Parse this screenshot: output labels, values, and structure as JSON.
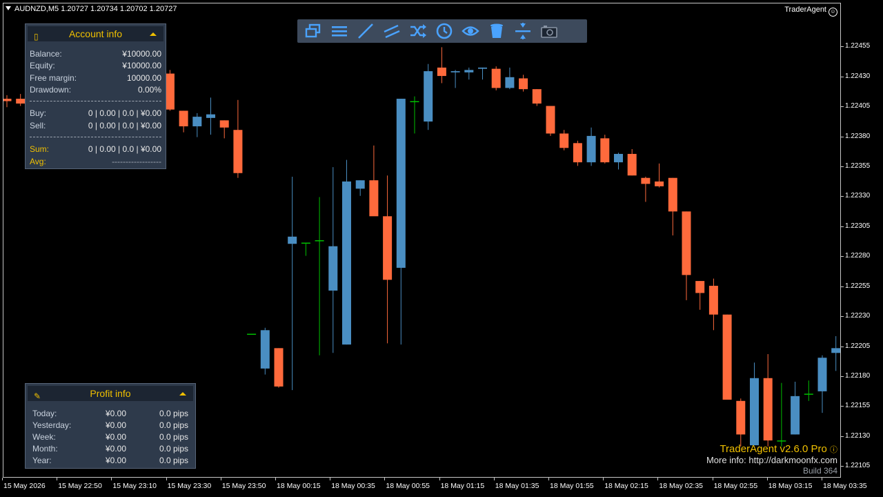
{
  "header": {
    "symbol_line": "AUDNZD,M5  1.20727 1.20734 1.20702 1.20727",
    "brand": "TraderAgent"
  },
  "colors": {
    "bull": "#4a8ec2",
    "bear": "#ff6a3c",
    "flat": "#00c000",
    "panel_bg": "#2e3a4b",
    "accent": "#f0c000"
  },
  "toolbar": {
    "tools": [
      {
        "icon": "windows-icon"
      },
      {
        "icon": "menu-icon"
      },
      {
        "icon": "trendline-icon"
      },
      {
        "icon": "parallel-lines-icon"
      },
      {
        "icon": "shuffle-icon"
      },
      {
        "icon": "clock-icon"
      },
      {
        "icon": "eye-icon"
      },
      {
        "icon": "trash-icon"
      },
      {
        "icon": "compress-icon"
      },
      {
        "icon": "camera-icon"
      }
    ]
  },
  "account": {
    "title": "Account info",
    "balance_label": "Balance:",
    "balance": "¥10000.00",
    "equity_label": "Equity:",
    "equity": "¥10000.00",
    "free_margin_label": "Free margin:",
    "free_margin": "10000.00",
    "drawdown_label": "Drawdown:",
    "drawdown": "0.00%",
    "buy_label": "Buy:",
    "buy": "0 | 0.00 | 0.0 | ¥0.00",
    "sell_label": "Sell:",
    "sell": "0 | 0.00 | 0.0 | ¥0.00",
    "sum_label": "Sum:",
    "sum": "0 | 0.00 | 0.0 | ¥0.00",
    "avg_label": "Avg:",
    "avg": "------------------"
  },
  "profit": {
    "title": "Profit info",
    "rows": [
      {
        "label": "Today:",
        "money": "¥0.00",
        "pips": "0.0 pips"
      },
      {
        "label": "Yesterday:",
        "money": "¥0.00",
        "pips": "0.0 pips"
      },
      {
        "label": "Week:",
        "money": "¥0.00",
        "pips": "0.0 pips"
      },
      {
        "label": "Month:",
        "money": "¥0.00",
        "pips": "0.0 pips"
      },
      {
        "label": "Year:",
        "money": "¥0.00",
        "pips": "0.0 pips"
      }
    ]
  },
  "footer": {
    "version": "TraderAgent v2.6.0 Pro",
    "more_info": "More info: http://darkmoonfx.com",
    "build": "Build 364"
  },
  "chart_data": {
    "type": "candlestick",
    "symbol": "AUDNZD",
    "timeframe": "M5",
    "ylim": [
      1.221,
      1.22465
    ],
    "price_ticks": [
      "1.22455",
      "1.22430",
      "1.22405",
      "1.22380",
      "1.22355",
      "1.22330",
      "1.22305",
      "1.22280",
      "1.22255",
      "1.22230",
      "1.22205",
      "1.22180",
      "1.22155",
      "1.22130",
      "1.22105"
    ],
    "time_ticks": [
      "15 May 2026",
      "15 May 22:50",
      "15 May 23:10",
      "15 May 23:30",
      "15 May 23:50",
      "18 May 00:15",
      "18 May 00:35",
      "18 May 00:55",
      "18 May 01:15",
      "18 May 01:35",
      "18 May 01:55",
      "18 May 02:15",
      "18 May 02:35",
      "18 May 02:55",
      "18 May 03:15",
      "18 May 03:35"
    ],
    "candles": [
      {
        "o": 1.22412,
        "h": 1.22415,
        "l": 1.22405,
        "c": 1.2241
      },
      {
        "o": 1.22412,
        "h": 1.22416,
        "l": 1.22406,
        "c": 1.22408
      },
      {
        "o": 1.22408,
        "h": 1.22418,
        "l": 1.22405,
        "c": 1.22412
      },
      {
        "o": 1.2241,
        "h": 1.22416,
        "l": 1.22404,
        "c": 1.2241
      },
      {
        "o": 1.22408,
        "h": 1.22416,
        "l": 1.224,
        "c": 1.22406
      },
      {
        "o": 1.22412,
        "h": 1.22432,
        "l": 1.22404,
        "c": 1.22424
      },
      {
        "o": 1.22425,
        "h": 1.22428,
        "l": 1.22404,
        "c": 1.22409
      },
      {
        "o": 1.22411,
        "h": 1.22413,
        "l": 1.22406,
        "c": 1.22408
      },
      {
        "o": 1.2241,
        "h": 1.22416,
        "l": 1.22405,
        "c": 1.22412
      },
      {
        "o": 1.22414,
        "h": 1.22418,
        "l": 1.22394,
        "c": 1.224
      },
      {
        "o": 1.224,
        "h": 1.22409,
        "l": 1.22396,
        "c": 1.22404
      },
      {
        "o": 1.22404,
        "h": 1.22434,
        "l": 1.224,
        "c": 1.22434
      },
      {
        "o": 1.22433,
        "h": 1.22436,
        "l": 1.22402,
        "c": 1.22403
      },
      {
        "o": 1.22402,
        "h": 1.22402,
        "l": 1.22384,
        "c": 1.22389
      },
      {
        "o": 1.22389,
        "h": 1.224,
        "l": 1.2238,
        "c": 1.22397
      },
      {
        "o": 1.22396,
        "h": 1.22413,
        "l": 1.22382,
        "c": 1.22399
      },
      {
        "o": 1.22394,
        "h": 1.22394,
        "l": 1.22379,
        "c": 1.22388
      },
      {
        "o": 1.22386,
        "h": 1.22411,
        "l": 1.22346,
        "c": 1.2235
      },
      {
        "o": 1.22216,
        "h": 1.22216,
        "l": 1.22216,
        "c": 1.22216
      },
      {
        "o": 1.22187,
        "h": 1.22221,
        "l": 1.22182,
        "c": 1.22219
      },
      {
        "o": 1.22204,
        "h": 1.22204,
        "l": 1.22171,
        "c": 1.22172
      },
      {
        "o": 1.22291,
        "h": 1.22347,
        "l": 1.22169,
        "c": 1.22297
      },
      {
        "o": 1.22292,
        "h": 1.22292,
        "l": 1.22281,
        "c": 1.22292
      },
      {
        "o": 1.22294,
        "h": 1.2233,
        "l": 1.22198,
        "c": 1.22294
      },
      {
        "o": 1.22252,
        "h": 1.22355,
        "l": 1.222,
        "c": 1.22289
      },
      {
        "o": 1.22207,
        "h": 1.22361,
        "l": 1.22207,
        "c": 1.22343
      },
      {
        "o": 1.22337,
        "h": 1.22344,
        "l": 1.22331,
        "c": 1.22344
      },
      {
        "o": 1.22344,
        "h": 1.22373,
        "l": 1.22317,
        "c": 1.22314
      },
      {
        "o": 1.22314,
        "h": 1.22348,
        "l": 1.22208,
        "c": 1.22261
      },
      {
        "o": 1.22271,
        "h": 1.22412,
        "l": 1.22207,
        "c": 1.22412
      },
      {
        "o": 1.2241,
        "h": 1.22414,
        "l": 1.22383,
        "c": 1.2241
      },
      {
        "o": 1.22393,
        "h": 1.22441,
        "l": 1.22386,
        "c": 1.22435
      },
      {
        "o": 1.22438,
        "h": 1.22455,
        "l": 1.22425,
        "c": 1.22431
      },
      {
        "o": 1.22434,
        "h": 1.22436,
        "l": 1.22421,
        "c": 1.22435
      },
      {
        "o": 1.22434,
        "h": 1.22438,
        "l": 1.22428,
        "c": 1.22436
      },
      {
        "o": 1.22437,
        "h": 1.22438,
        "l": 1.22428,
        "c": 1.22438
      },
      {
        "o": 1.22437,
        "h": 1.22439,
        "l": 1.22419,
        "c": 1.22421
      },
      {
        "o": 1.22421,
        "h": 1.22438,
        "l": 1.2242,
        "c": 1.2243
      },
      {
        "o": 1.22429,
        "h": 1.22432,
        "l": 1.22418,
        "c": 1.2242
      },
      {
        "o": 1.2242,
        "h": 1.2242,
        "l": 1.22406,
        "c": 1.22408
      },
      {
        "o": 1.22406,
        "h": 1.22406,
        "l": 1.22381,
        "c": 1.22383
      },
      {
        "o": 1.22383,
        "h": 1.22386,
        "l": 1.22369,
        "c": 1.22371
      },
      {
        "o": 1.22375,
        "h": 1.22377,
        "l": 1.22356,
        "c": 1.22359
      },
      {
        "o": 1.22359,
        "h": 1.22388,
        "l": 1.22356,
        "c": 1.22381
      },
      {
        "o": 1.22379,
        "h": 1.22382,
        "l": 1.22358,
        "c": 1.22359
      },
      {
        "o": 1.22359,
        "h": 1.22367,
        "l": 1.22353,
        "c": 1.22366
      },
      {
        "o": 1.22366,
        "h": 1.2237,
        "l": 1.22348,
        "c": 1.22348
      },
      {
        "o": 1.22346,
        "h": 1.22347,
        "l": 1.22326,
        "c": 1.22341
      },
      {
        "o": 1.22343,
        "h": 1.22358,
        "l": 1.22338,
        "c": 1.22339
      },
      {
        "o": 1.22346,
        "h": 1.22346,
        "l": 1.22298,
        "c": 1.22318
      },
      {
        "o": 1.22318,
        "h": 1.22318,
        "l": 1.22244,
        "c": 1.22265
      },
      {
        "o": 1.2226,
        "h": 1.2226,
        "l": 1.22236,
        "c": 1.2225
      },
      {
        "o": 1.22256,
        "h": 1.22262,
        "l": 1.22219,
        "c": 1.22232
      },
      {
        "o": 1.22232,
        "h": 1.22232,
        "l": 1.22164,
        "c": 1.22161
      },
      {
        "o": 1.2216,
        "h": 1.22162,
        "l": 1.22122,
        "c": 1.22132
      },
      {
        "o": 1.22123,
        "h": 1.22192,
        "l": 1.22123,
        "c": 1.22179
      },
      {
        "o": 1.22179,
        "h": 1.22199,
        "l": 1.22122,
        "c": 1.22127
      },
      {
        "o": 1.22127,
        "h": 1.22175,
        "l": 1.22122,
        "c": 1.22127
      },
      {
        "o": 1.22132,
        "h": 1.22176,
        "l": 1.22132,
        "c": 1.22164
      },
      {
        "o": 1.22166,
        "h": 1.22177,
        "l": 1.2216,
        "c": 1.22166
      },
      {
        "o": 1.22168,
        "h": 1.22198,
        "l": 1.2215,
        "c": 1.22196
      },
      {
        "o": 1.222,
        "h": 1.22214,
        "l": 1.22185,
        "c": 1.22204
      }
    ]
  }
}
